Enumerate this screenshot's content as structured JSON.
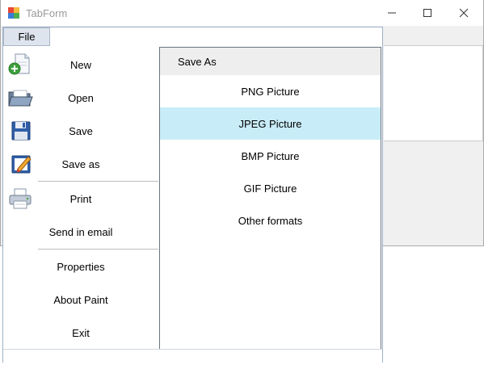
{
  "window": {
    "title": "TabForm"
  },
  "menubar": {
    "file_label": "File"
  },
  "file_menu": {
    "items": [
      {
        "label": "New",
        "icon": "new-document-icon"
      },
      {
        "label": "Open",
        "icon": "open-folder-icon"
      },
      {
        "label": "Save",
        "icon": "floppy-disk-icon"
      },
      {
        "label": "Save as",
        "icon": "save-as-pencil-icon"
      },
      {
        "label": "Print",
        "icon": "printer-icon"
      },
      {
        "label": "Send in email",
        "icon": ""
      },
      {
        "label": "Properties",
        "icon": ""
      },
      {
        "label": "About Paint",
        "icon": ""
      },
      {
        "label": "Exit",
        "icon": ""
      }
    ]
  },
  "save_as_panel": {
    "header": "Save As",
    "options": [
      {
        "label": "PNG Picture",
        "selected": false
      },
      {
        "label": "JPEG Picture",
        "selected": true
      },
      {
        "label": "BMP Picture",
        "selected": false
      },
      {
        "label": "GIF Picture",
        "selected": false
      },
      {
        "label": "Other formats",
        "selected": false
      }
    ]
  },
  "colors": {
    "selected_bg": "#c9edf8",
    "header_bg": "#eeeeee",
    "menu_border": "#9fb1c9"
  }
}
